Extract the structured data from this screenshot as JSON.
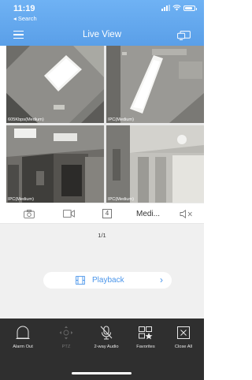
{
  "status_bar": {
    "time": "11:19",
    "back_label": "◂ Search"
  },
  "nav": {
    "title": "Live View",
    "menu_icon": "hamburger-menu-icon",
    "screens_icon": "screen-mirror-icon"
  },
  "cameras": [
    {
      "label": "605Kbps(Medium)"
    },
    {
      "label": "IPC(Medium)"
    },
    {
      "label": "IPC(Medium)"
    },
    {
      "label": "IPC(Medium)"
    }
  ],
  "toolbar": {
    "split_count": "4",
    "stream_quality": "Medi...",
    "icons": [
      "camera-snapshot-icon",
      "video-record-icon",
      "split-screen-icon",
      "speaker-mute-icon"
    ]
  },
  "page_indicator": "1/1",
  "playback": {
    "label": "Playback",
    "arrow": "›"
  },
  "bottom_bar": {
    "items": [
      {
        "label": "Alarm Out",
        "icon": "alarm-out-icon",
        "enabled": true
      },
      {
        "label": "PTZ",
        "icon": "ptz-icon",
        "enabled": false
      },
      {
        "label": "2-way Audio",
        "icon": "two-way-audio-icon",
        "enabled": true
      },
      {
        "label": "Favorites",
        "icon": "favorites-icon",
        "enabled": true
      },
      {
        "label": "Close All",
        "icon": "close-all-icon",
        "enabled": true
      }
    ]
  },
  "colors": {
    "header_blue": "#5a9fe8",
    "accent_blue": "#4a95ea",
    "bottom_bar": "#2f2f2f",
    "content_bg": "#f0f0f0"
  }
}
